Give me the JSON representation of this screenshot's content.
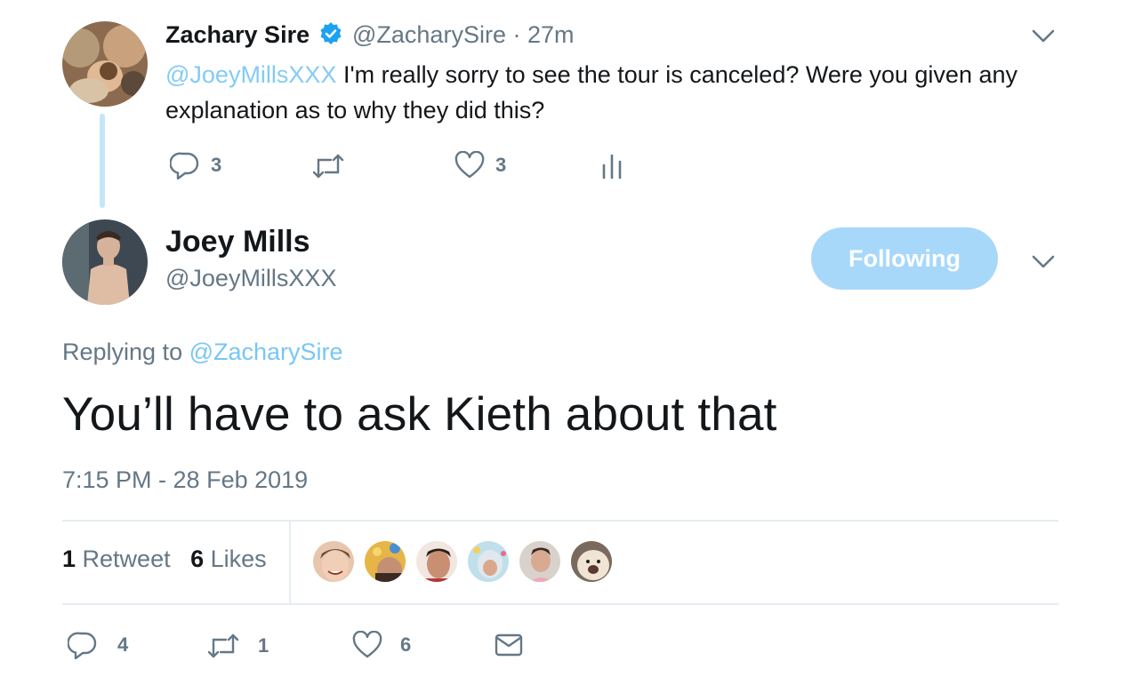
{
  "parent_tweet": {
    "name": "Zachary Sire",
    "handle_time": "@ZacharySire · 27m",
    "mention": "@JoeyMillsXXX",
    "text": " I'm really sorry to see the tour is canceled? Were you given any explanation as to why they did this?",
    "replies": "3",
    "likes": "3",
    "icons": {
      "reply": "reply-icon",
      "retweet": "retweet-icon",
      "like": "heart-icon",
      "analytics": "analytics-icon",
      "verified": "verified-badge-icon",
      "caret": "chevron-down-icon"
    }
  },
  "main_tweet": {
    "name": "Joey Mills",
    "handle": "@JoeyMillsXXX",
    "follow_label": "Following",
    "replying_prefix": "Replying to ",
    "replying_to": "@ZacharySire",
    "text": "You’ll have to ask Kieth about that",
    "timestamp": "7:15 PM - 28 Feb 2019",
    "retweet_count": "1",
    "retweet_label": " Retweet",
    "like_count": "6",
    "like_label": " Likes"
  },
  "bottom_actions": {
    "replies": "4",
    "retweets": "1",
    "likes": "6"
  },
  "colors": {
    "accent": "#1da1f2",
    "follow_button": "#a7d8fa",
    "muted_text": "#657786",
    "thread_line": "#c4e6fb"
  }
}
